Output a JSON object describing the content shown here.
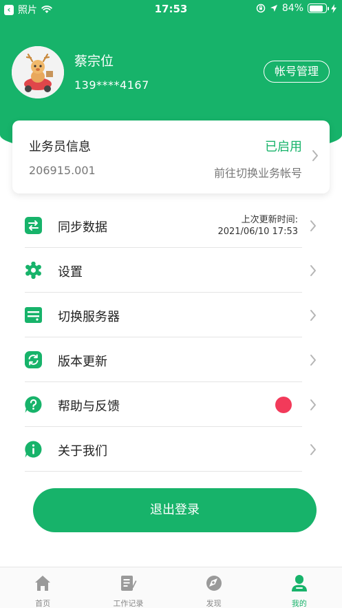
{
  "status_bar": {
    "back_label": "照片",
    "time": "17:53",
    "battery": "84%",
    "battery_level": 0.84
  },
  "profile": {
    "name": "蔡宗位",
    "phone": "139****4167",
    "account_button": "帐号管理"
  },
  "agent_card": {
    "title": "业务员信息",
    "status": "已启用",
    "id": "206915.001",
    "switch_label": "前往切换业务帐号"
  },
  "menu": [
    {
      "label": "同步数据",
      "icon": "sync-icon",
      "extra_line1": "上次更新时间:",
      "extra_line2": "2021/06/10 17:53"
    },
    {
      "label": "设置",
      "icon": "gear-icon"
    },
    {
      "label": "切换服务器",
      "icon": "server-icon"
    },
    {
      "label": "版本更新",
      "icon": "refresh-icon"
    },
    {
      "label": "帮助与反馈",
      "icon": "help-icon",
      "badge": "red-dot"
    },
    {
      "label": "关于我们",
      "icon": "info-icon"
    }
  ],
  "logout_label": "退出登录",
  "tabs": [
    {
      "label": "首页",
      "icon": "home-icon",
      "active": false
    },
    {
      "label": "工作记录",
      "icon": "notebook-icon",
      "active": false
    },
    {
      "label": "发现",
      "icon": "compass-icon",
      "active": false
    },
    {
      "label": "我的",
      "icon": "person-icon",
      "active": true
    }
  ],
  "colors": {
    "brand_green": "#17b36a",
    "badge_red": "#f23a5a"
  }
}
